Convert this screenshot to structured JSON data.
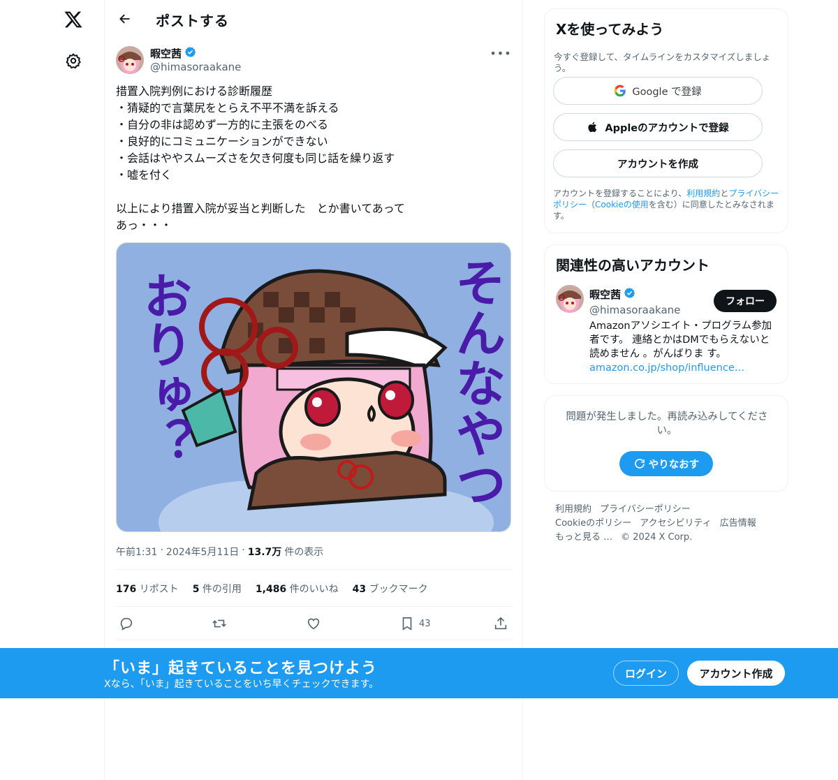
{
  "nav": {
    "logo_icon": "x-logo-icon",
    "settings_icon": "gear-icon"
  },
  "header": {
    "title": "ポストする"
  },
  "post": {
    "author_name": "暇空茜",
    "author_handle": "@himasoraakane",
    "verified": true,
    "text_lines": [
      "措置入院判例における診断履歴",
      "・猜疑的で言葉尻をとらえ不平不満を訴える",
      "・自分の非は認めず一方的に主張をのべる",
      "・良好的にコミュニケーションができない",
      "・会話はややスムーズさを欠き何度も同じ話を繰り返す",
      "・嘘を付く",
      "",
      "以上により措置入院が妥当と判断した　とか書いてあって",
      "あっ・・・"
    ],
    "media": {
      "left_text": "おりゅ？",
      "right_text": "そんなやつ",
      "bg_color": "#8fb0e0",
      "text_color": "#4a1aa8"
    },
    "time": "午前1:31",
    "date": "2024年5月11日",
    "views_count": "13.7万",
    "views_label": "件の表示",
    "stats": {
      "reposts_count": "176",
      "reposts_label": "リポスト",
      "quotes_count": "5",
      "quotes_label": "件の引用",
      "likes_count": "1,486",
      "likes_label": "件のいいね",
      "bookmarks_count": "43",
      "bookmarks_label": "ブックマーク"
    },
    "actions": {
      "bookmark_count": "43"
    }
  },
  "signup": {
    "title": "Xを使ってみよう",
    "subtitle": "今すぐ登録して、タイムラインをカスタマイズしましょう。",
    "google_label": "Google で登録",
    "apple_label": "Appleのアカウントで登録",
    "create_label": "アカウントを作成",
    "legal_prefix": "アカウントを登録することにより、",
    "terms": "利用規約",
    "and": "と",
    "privacy": "プライバシーポリシー",
    "paren_open": "（",
    "cookie": "Cookieの使用",
    "legal_suffix": "を含む）に同意したとみなされます。"
  },
  "related": {
    "title": "関連性の高いアカウント",
    "name": "暇空茜",
    "handle": "@himasoraakane",
    "follow_label": "フォロー",
    "bio": "Amazonアソシエイト・プログラム参加者です。 連絡とかはDMでもらえないと読めません 。がんばりま す。",
    "bio_link": "amazon.co.jp/shop/influence…"
  },
  "error_card": {
    "message": "問題が発生しました。再読み込みしてください。",
    "retry_label": "やりなおす"
  },
  "footer": {
    "terms": "利用規約",
    "privacy": "プライバシーポリシー",
    "cookie": "Cookieのポリシー",
    "accessibility": "アクセシビリティ",
    "ads": "広告情報",
    "more": "もっと見る …",
    "copyright": "© 2024 X Corp."
  },
  "banner": {
    "title": "「いま」起きていることを見つけよう",
    "subtitle": "Xなら、「いま」起きていることをいち早くチェックできます。",
    "login_label": "ログイン",
    "signup_label": "アカウント作成"
  },
  "colors": {
    "accent": "#1d9bf0",
    "text": "#0f1419",
    "muted": "#536471"
  }
}
